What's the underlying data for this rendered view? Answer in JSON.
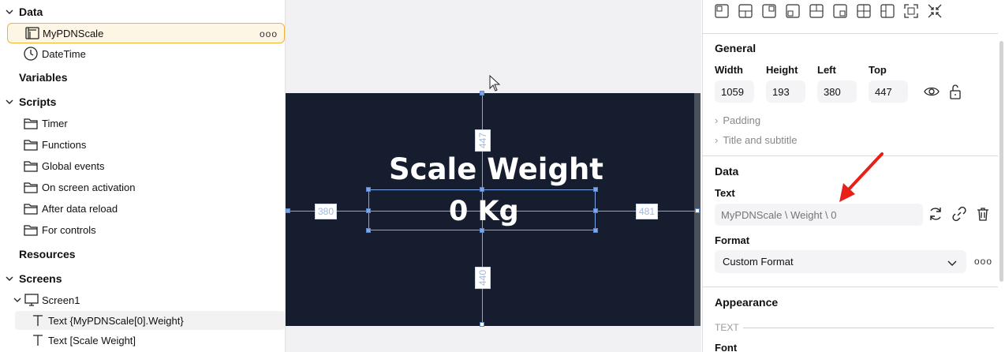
{
  "tree": {
    "data_section": "Data",
    "data_items": [
      {
        "label": "MyPDNScale",
        "icon": "database-table-icon",
        "more": "ooo"
      },
      {
        "label": "DateTime",
        "icon": "clock-icon"
      }
    ],
    "variables_section": "Variables",
    "scripts_section": "Scripts",
    "script_folders": [
      "Timer",
      "Functions",
      "Global events",
      "On screen activation",
      "After data reload",
      "For controls"
    ],
    "resources_section": "Resources",
    "screens_section": "Screens",
    "screen_name": "Screen1",
    "screen_items": [
      "Text {MyPDNScale[0].Weight}",
      "Text [Scale Weight]"
    ]
  },
  "canvas": {
    "title_text": "Scale Weight",
    "value_text": "0 Kg",
    "dim_top": "447",
    "dim_left": "380",
    "dim_right": "481",
    "dim_bottom": "440",
    "stage_color": "#151d2e",
    "guide_color": "#7ea6e8"
  },
  "props": {
    "general_header": "General",
    "width_label": "Width",
    "width_value": "1059",
    "height_label": "Height",
    "height_value": "193",
    "left_label": "Left",
    "left_value": "380",
    "top_label": "Top",
    "top_value": "447",
    "padding_label": "Padding",
    "title_subtitle_label": "Title and subtitle",
    "data_header": "Data",
    "text_label": "Text",
    "text_placeholder": "MyPDNScale \\ Weight \\ 0",
    "format_label": "Format",
    "format_value": "Custom Format",
    "appearance_header": "Appearance",
    "text_group_label": "TEXT",
    "font_label": "Font",
    "more": "ooo",
    "arrow_color": "#e8201a"
  }
}
